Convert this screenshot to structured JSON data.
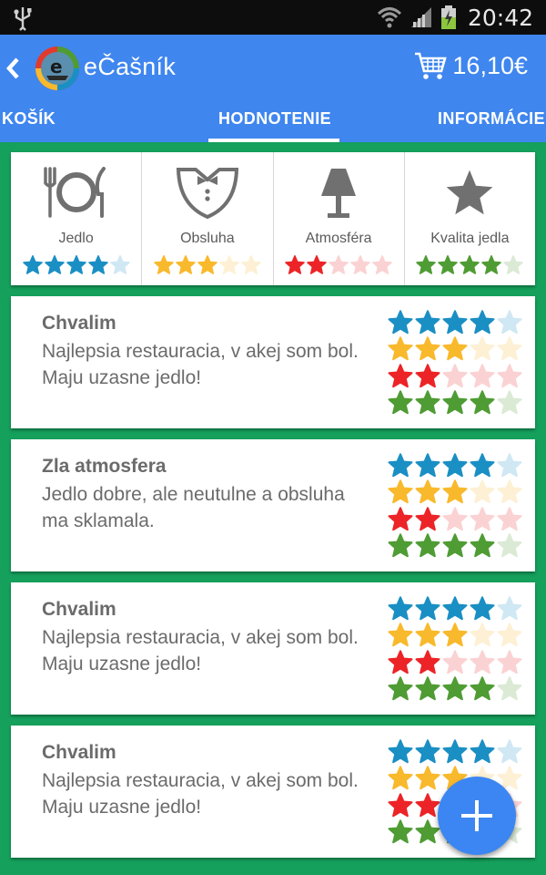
{
  "status_bar": {
    "time": "20:42"
  },
  "header": {
    "app_title": "eČašník",
    "cart_total": "16,10€"
  },
  "tabs": [
    {
      "label": "KOŠÍK"
    },
    {
      "label": "HODNOTENIE",
      "selected": true
    },
    {
      "label": "INFORMÁCIE"
    }
  ],
  "colors": {
    "food": "#1a8fc4",
    "service": "#f9b92c",
    "atmosphere": "#ec2427",
    "quality": "#4f9c34",
    "app_bar": "#3f86ef",
    "background": "#15a05c",
    "fab": "#3b86f2"
  },
  "categories": [
    {
      "label": "Jedlo",
      "icon": "plate-cutlery-icon",
      "rating": 4
    },
    {
      "label": "Obsluha",
      "icon": "waiter-tuxedo-icon",
      "rating": 3
    },
    {
      "label": "Atmosféra",
      "icon": "lamp-icon",
      "rating": 2
    },
    {
      "label": "Kvalita jedla",
      "icon": "star-icon",
      "rating": 4
    }
  ],
  "reviews": [
    {
      "title": "Chvalim",
      "text": "Najlepsia restauracia, v akej som bol. Maju uzasne jedlo!",
      "ratings": [
        4,
        3,
        2,
        4
      ]
    },
    {
      "title": "Zla atmosfera",
      "text": "Jedlo dobre, ale neutulne a obsluha ma sklamala.",
      "ratings": [
        4,
        3,
        2,
        4
      ]
    },
    {
      "title": "Chvalim",
      "text": "Najlepsia restauracia, v akej som bol. Maju uzasne jedlo!",
      "ratings": [
        4,
        3,
        2,
        4
      ]
    },
    {
      "title": "Chvalim",
      "text": "Najlepsia restauracia, v akej som bol. Maju uzasne jedlo!",
      "ratings": [
        4,
        3,
        2,
        4
      ]
    }
  ],
  "fab": {
    "icon": "plus-icon"
  }
}
